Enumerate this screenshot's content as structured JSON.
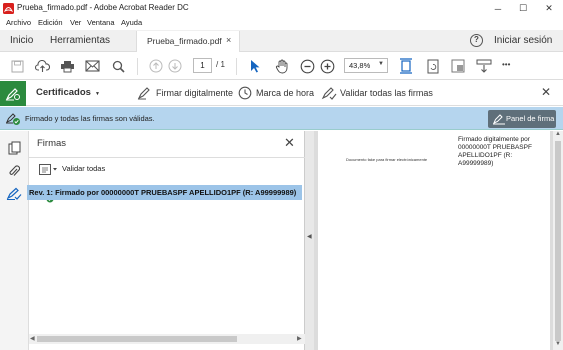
{
  "window": {
    "title": "Prueba_firmado.pdf - Adobe Acrobat Reader DC",
    "minimize": "─",
    "maximize": "☐",
    "close": "✕"
  },
  "menu": [
    "Archivo",
    "Edición",
    "Ver",
    "Ventana",
    "Ayuda"
  ],
  "tabs": {
    "home": "Inicio",
    "tools": "Herramientas",
    "document": "Prueba_firmado.pdf",
    "doc_close": "×",
    "help": "?",
    "signin": "Iniciar sesión"
  },
  "toolbar": {
    "page_current": "1",
    "page_total": "/ 1",
    "zoom": "43,8%",
    "more": "•••"
  },
  "certbar": {
    "title": "Certificados",
    "sign": "Firmar digitalmente",
    "timestamp": "Marca de hora",
    "validate_all": "Validar todas las firmas",
    "close": "✕"
  },
  "status": {
    "message": "Firmado y todas las firmas son válidas.",
    "panel_button": "Panel de firma"
  },
  "sigpanel": {
    "title": "Firmas",
    "close": "✕",
    "validate_all": "Validar todas",
    "signature_row": "Rev. 1: Firmado por 00000000T PRUEBASPF APELLIDO1PF (R: A99999989)"
  },
  "document": {
    "small_text": "Documento fake para firmar electrónicamente",
    "signature_lines": [
      "Firmado digitalmente por",
      "00000000T PRUEBASPF",
      "APELLIDO1PF (R:",
      "A99999989)"
    ]
  },
  "colors": {
    "accent_green": "#2b8a3e",
    "status_blue": "#b5d5ee",
    "selection_blue": "#9cc4e8"
  }
}
